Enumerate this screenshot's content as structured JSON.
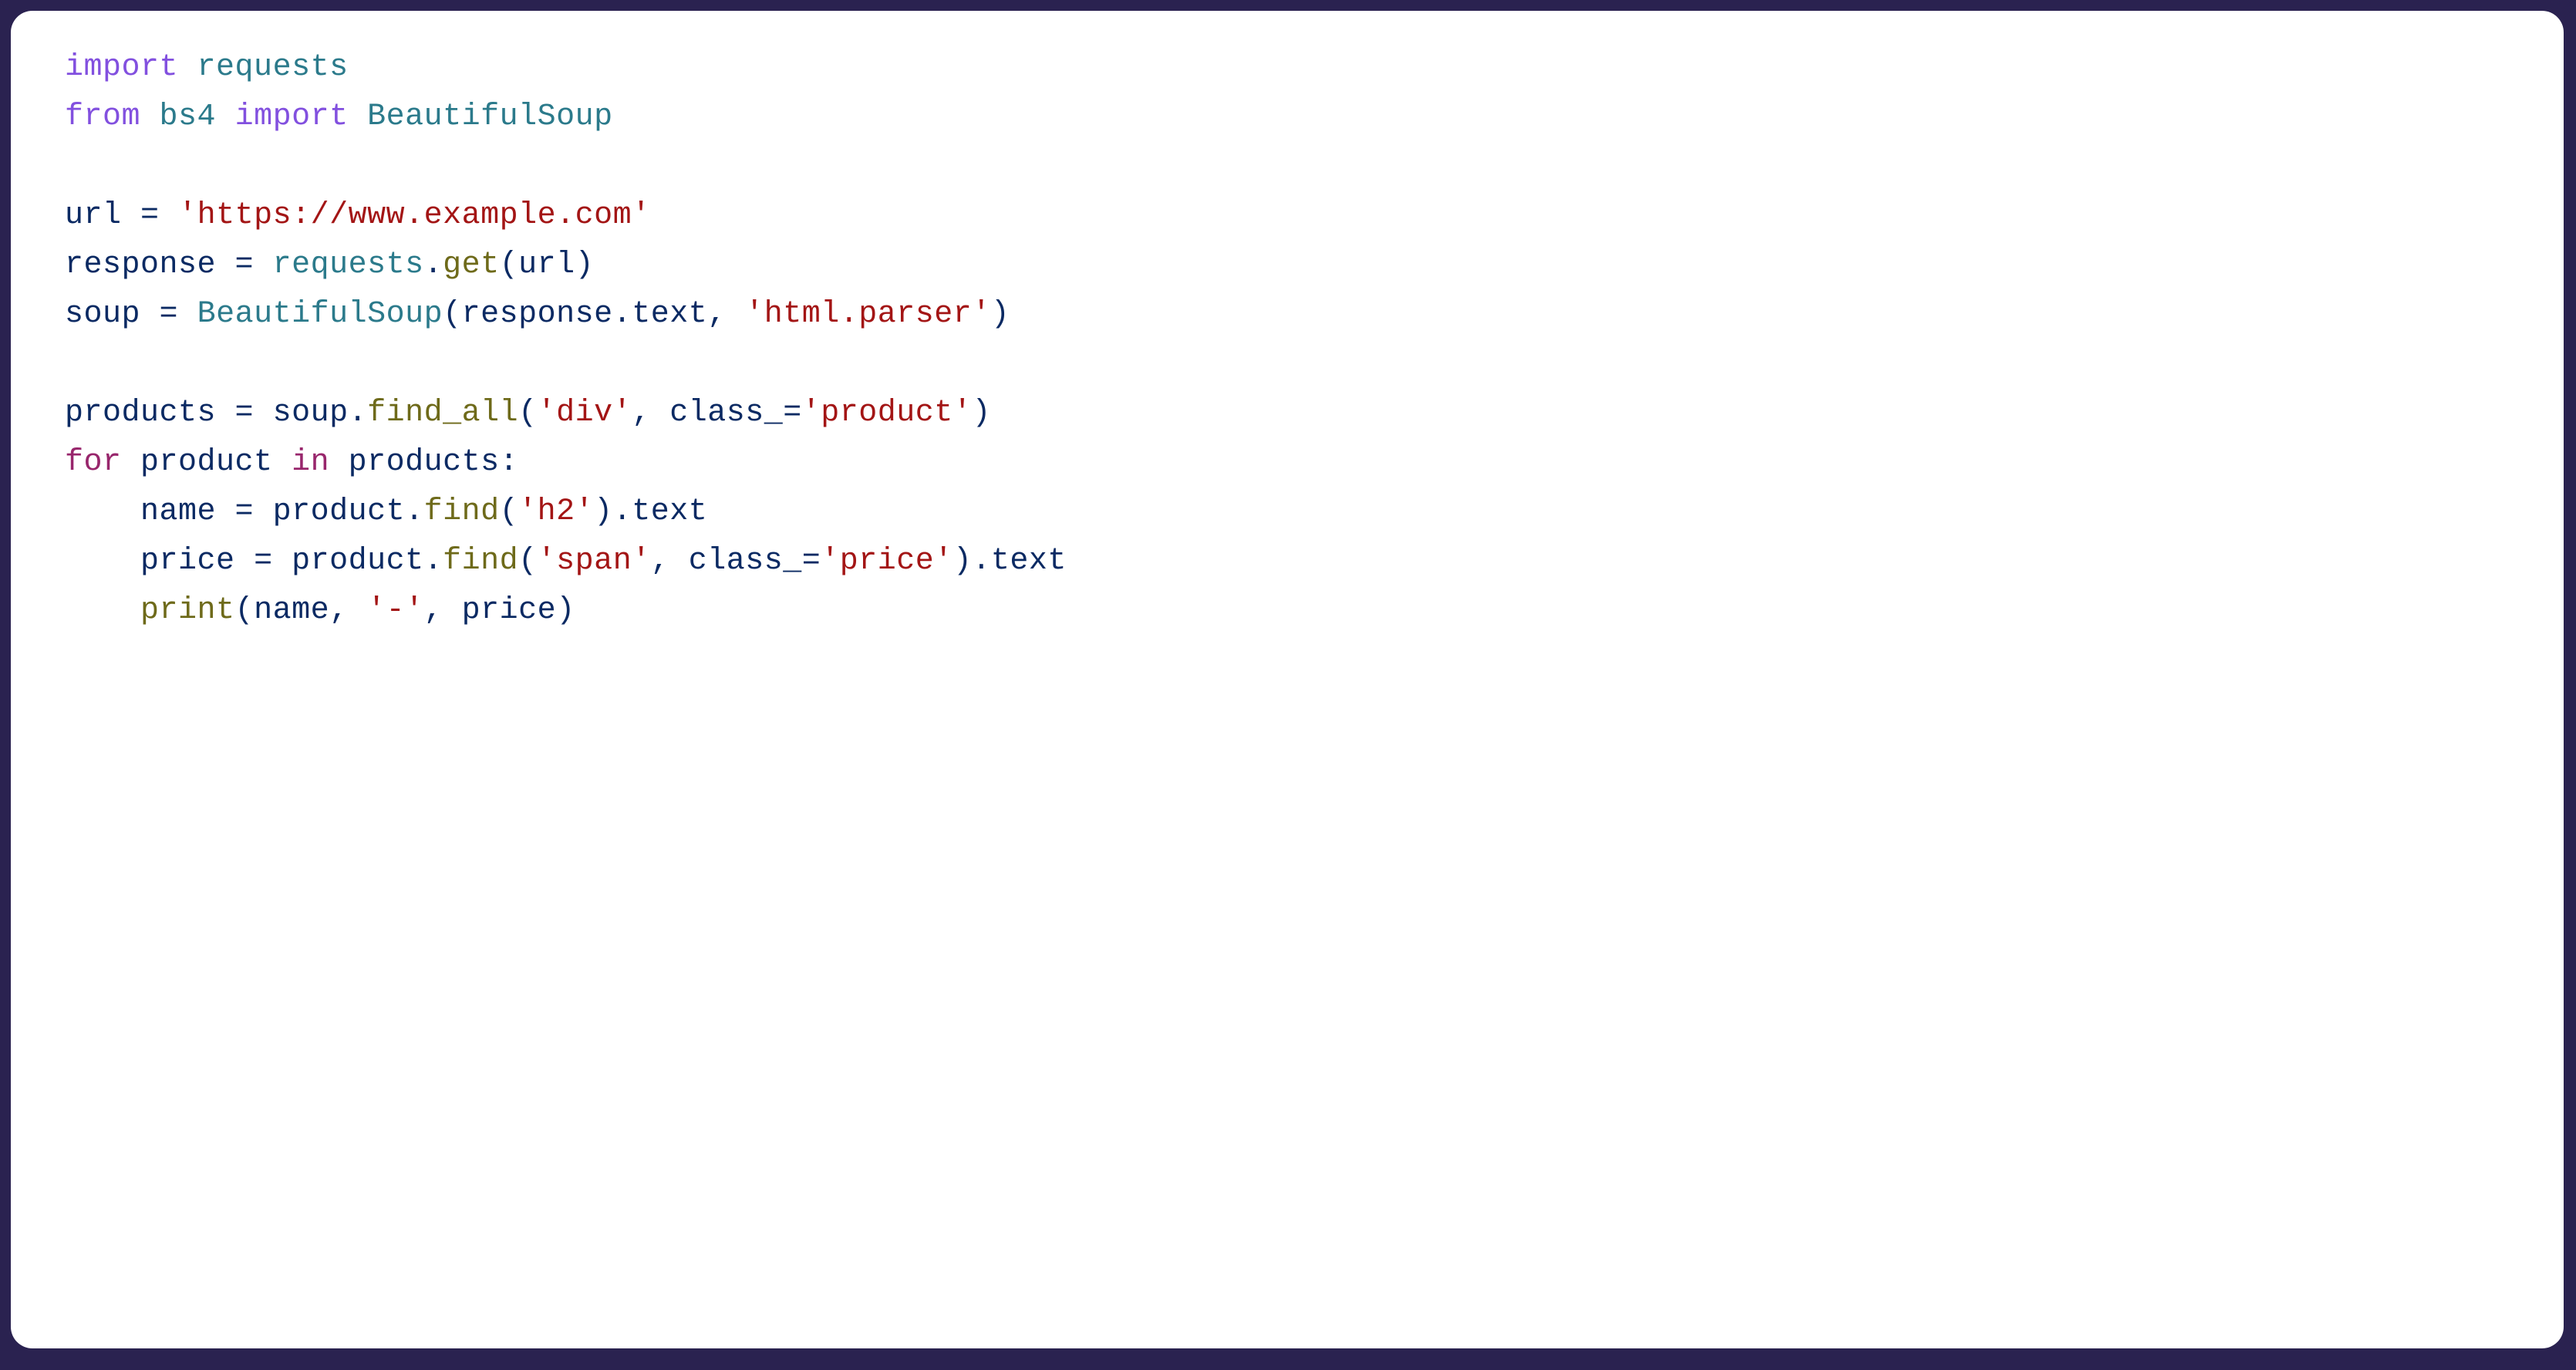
{
  "code": {
    "lines": [
      {
        "indent": 0,
        "tokens": [
          {
            "cls": "tok-kw",
            "t": "import"
          },
          {
            "cls": "",
            "t": " "
          },
          {
            "cls": "tok-mod",
            "t": "requests"
          }
        ]
      },
      {
        "indent": 0,
        "tokens": [
          {
            "cls": "tok-kw",
            "t": "from"
          },
          {
            "cls": "",
            "t": " "
          },
          {
            "cls": "tok-mod",
            "t": "bs4"
          },
          {
            "cls": "",
            "t": " "
          },
          {
            "cls": "tok-kw",
            "t": "import"
          },
          {
            "cls": "",
            "t": " "
          },
          {
            "cls": "tok-mod",
            "t": "BeautifulSoup"
          }
        ]
      },
      {
        "indent": 0,
        "tokens": []
      },
      {
        "indent": 0,
        "tokens": [
          {
            "cls": "tok-var",
            "t": "url"
          },
          {
            "cls": "",
            "t": " "
          },
          {
            "cls": "tok-op",
            "t": "="
          },
          {
            "cls": "",
            "t": " "
          },
          {
            "cls": "tok-str",
            "t": "'https://www.example.com'"
          }
        ]
      },
      {
        "indent": 0,
        "tokens": [
          {
            "cls": "tok-var",
            "t": "response"
          },
          {
            "cls": "",
            "t": " "
          },
          {
            "cls": "tok-op",
            "t": "="
          },
          {
            "cls": "",
            "t": " "
          },
          {
            "cls": "tok-mod",
            "t": "requests"
          },
          {
            "cls": "tok-op",
            "t": "."
          },
          {
            "cls": "tok-fn",
            "t": "get"
          },
          {
            "cls": "tok-op",
            "t": "("
          },
          {
            "cls": "tok-var",
            "t": "url"
          },
          {
            "cls": "tok-op",
            "t": ")"
          }
        ]
      },
      {
        "indent": 0,
        "tokens": [
          {
            "cls": "tok-var",
            "t": "soup"
          },
          {
            "cls": "",
            "t": " "
          },
          {
            "cls": "tok-op",
            "t": "="
          },
          {
            "cls": "",
            "t": " "
          },
          {
            "cls": "tok-mod",
            "t": "BeautifulSoup"
          },
          {
            "cls": "tok-op",
            "t": "("
          },
          {
            "cls": "tok-var",
            "t": "response"
          },
          {
            "cls": "tok-op",
            "t": "."
          },
          {
            "cls": "tok-attr",
            "t": "text"
          },
          {
            "cls": "tok-op",
            "t": ","
          },
          {
            "cls": "",
            "t": " "
          },
          {
            "cls": "tok-str",
            "t": "'html.parser'"
          },
          {
            "cls": "tok-op",
            "t": ")"
          }
        ]
      },
      {
        "indent": 0,
        "tokens": []
      },
      {
        "indent": 0,
        "tokens": [
          {
            "cls": "tok-var",
            "t": "products"
          },
          {
            "cls": "",
            "t": " "
          },
          {
            "cls": "tok-op",
            "t": "="
          },
          {
            "cls": "",
            "t": " "
          },
          {
            "cls": "tok-var",
            "t": "soup"
          },
          {
            "cls": "tok-op",
            "t": "."
          },
          {
            "cls": "tok-fn",
            "t": "find_all"
          },
          {
            "cls": "tok-op",
            "t": "("
          },
          {
            "cls": "tok-str",
            "t": "'div'"
          },
          {
            "cls": "tok-op",
            "t": ","
          },
          {
            "cls": "",
            "t": " "
          },
          {
            "cls": "tok-var",
            "t": "class_"
          },
          {
            "cls": "tok-op",
            "t": "="
          },
          {
            "cls": "tok-str",
            "t": "'product'"
          },
          {
            "cls": "tok-op",
            "t": ")"
          }
        ]
      },
      {
        "indent": 0,
        "tokens": [
          {
            "cls": "tok-flow",
            "t": "for"
          },
          {
            "cls": "",
            "t": " "
          },
          {
            "cls": "tok-var",
            "t": "product"
          },
          {
            "cls": "",
            "t": " "
          },
          {
            "cls": "tok-flow",
            "t": "in"
          },
          {
            "cls": "",
            "t": " "
          },
          {
            "cls": "tok-var",
            "t": "products"
          },
          {
            "cls": "tok-op",
            "t": ":"
          }
        ]
      },
      {
        "indent": 1,
        "tokens": [
          {
            "cls": "tok-var",
            "t": "name"
          },
          {
            "cls": "",
            "t": " "
          },
          {
            "cls": "tok-op",
            "t": "="
          },
          {
            "cls": "",
            "t": " "
          },
          {
            "cls": "tok-var",
            "t": "product"
          },
          {
            "cls": "tok-op",
            "t": "."
          },
          {
            "cls": "tok-fn",
            "t": "find"
          },
          {
            "cls": "tok-op",
            "t": "("
          },
          {
            "cls": "tok-str",
            "t": "'h2'"
          },
          {
            "cls": "tok-op",
            "t": ")"
          },
          {
            "cls": "tok-op",
            "t": "."
          },
          {
            "cls": "tok-attr",
            "t": "text"
          }
        ]
      },
      {
        "indent": 1,
        "tokens": [
          {
            "cls": "tok-var",
            "t": "price"
          },
          {
            "cls": "",
            "t": " "
          },
          {
            "cls": "tok-op",
            "t": "="
          },
          {
            "cls": "",
            "t": " "
          },
          {
            "cls": "tok-var",
            "t": "product"
          },
          {
            "cls": "tok-op",
            "t": "."
          },
          {
            "cls": "tok-fn",
            "t": "find"
          },
          {
            "cls": "tok-op",
            "t": "("
          },
          {
            "cls": "tok-str",
            "t": "'span'"
          },
          {
            "cls": "tok-op",
            "t": ","
          },
          {
            "cls": "",
            "t": " "
          },
          {
            "cls": "tok-var",
            "t": "class_"
          },
          {
            "cls": "tok-op",
            "t": "="
          },
          {
            "cls": "tok-str",
            "t": "'price'"
          },
          {
            "cls": "tok-op",
            "t": ")"
          },
          {
            "cls": "tok-op",
            "t": "."
          },
          {
            "cls": "tok-attr",
            "t": "text"
          }
        ]
      },
      {
        "indent": 1,
        "tokens": [
          {
            "cls": "tok-fn",
            "t": "print"
          },
          {
            "cls": "tok-op",
            "t": "("
          },
          {
            "cls": "tok-var",
            "t": "name"
          },
          {
            "cls": "tok-op",
            "t": ","
          },
          {
            "cls": "",
            "t": " "
          },
          {
            "cls": "tok-str",
            "t": "'-'"
          },
          {
            "cls": "tok-op",
            "t": ","
          },
          {
            "cls": "",
            "t": " "
          },
          {
            "cls": "tok-var",
            "t": "price"
          },
          {
            "cls": "tok-op",
            "t": ")"
          }
        ]
      }
    ],
    "indent_unit": "    "
  }
}
